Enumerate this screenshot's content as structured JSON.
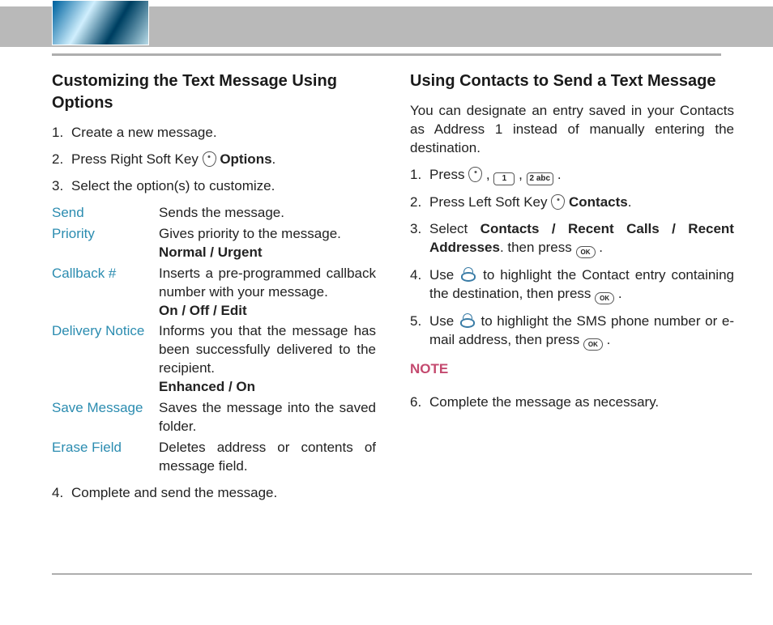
{
  "left": {
    "heading": "Customizing the Text Message Using Options",
    "step1": "Create a new message.",
    "step2_a": "Press Right Soft Key ",
    "step2_b": "Options",
    "step3": "Select the option(s) to customize.",
    "step4": "Complete and send the message.",
    "options": {
      "send": {
        "label": "Send",
        "desc": "Sends the message."
      },
      "priority": {
        "label": "Priority",
        "desc": "Gives priority to the message.",
        "sub": "Normal / Urgent"
      },
      "callback": {
        "label": "Callback #",
        "desc": "Inserts a pre-programmed callback number with your message.",
        "sub": "On / Off / Edit"
      },
      "delivery": {
        "label": "Delivery Notice",
        "desc": "Informs you that the message has been successfully delivered to the recipient.",
        "sub": "Enhanced / On"
      },
      "save": {
        "label": "Save Message",
        "desc": "Saves the message into the saved folder."
      },
      "erase": {
        "label": "Erase Field",
        "desc": "Deletes address or contents of message field."
      }
    }
  },
  "right": {
    "heading": "Using Contacts to Send a Text Message",
    "intro": "You can designate an entry saved in your Contacts as Address 1 instead of manually entering the destination.",
    "step1_a": "Press ",
    "key1": "1",
    "key2": "2 abc",
    "step2_a": "Press Left Soft Key ",
    "step2_b": "Contacts",
    "step3_a": "Select ",
    "step3_b": "Contacts / Recent Calls / Recent Addresses",
    "step3_c": ". then press ",
    "ok": "OK",
    "step4_a": "Use ",
    "step4_b": " to highlight the Contact entry containing the destination, then press ",
    "step5_a": "Use ",
    "step5_b": " to highlight the SMS phone number or e-mail address, then press ",
    "note": "NOTE",
    "step6": "Complete the message as necessary."
  }
}
